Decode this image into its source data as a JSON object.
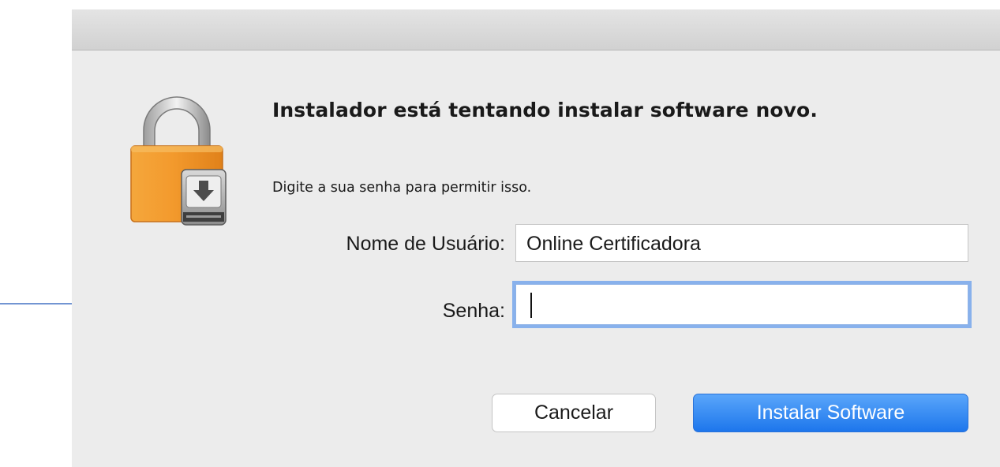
{
  "dialog": {
    "heading": "Instalador está tentando instalar software novo.",
    "subtext": "Digite a sua senha para permitir isso.",
    "icon": "lock-installer-icon"
  },
  "form": {
    "username_label": "Nome de Usuário:",
    "username_value": "Online Certificadora",
    "password_label": "Senha:",
    "password_value": ""
  },
  "buttons": {
    "cancel_label": "Cancelar",
    "install_label": "Instalar Software"
  },
  "annotation": {
    "arrow_icon": "arrow-right-icon",
    "arrow_color": "#4472c4"
  },
  "colors": {
    "accent": "#1d76ec",
    "focus_ring": "#88b1ec",
    "dialog_bg": "#ececec"
  }
}
